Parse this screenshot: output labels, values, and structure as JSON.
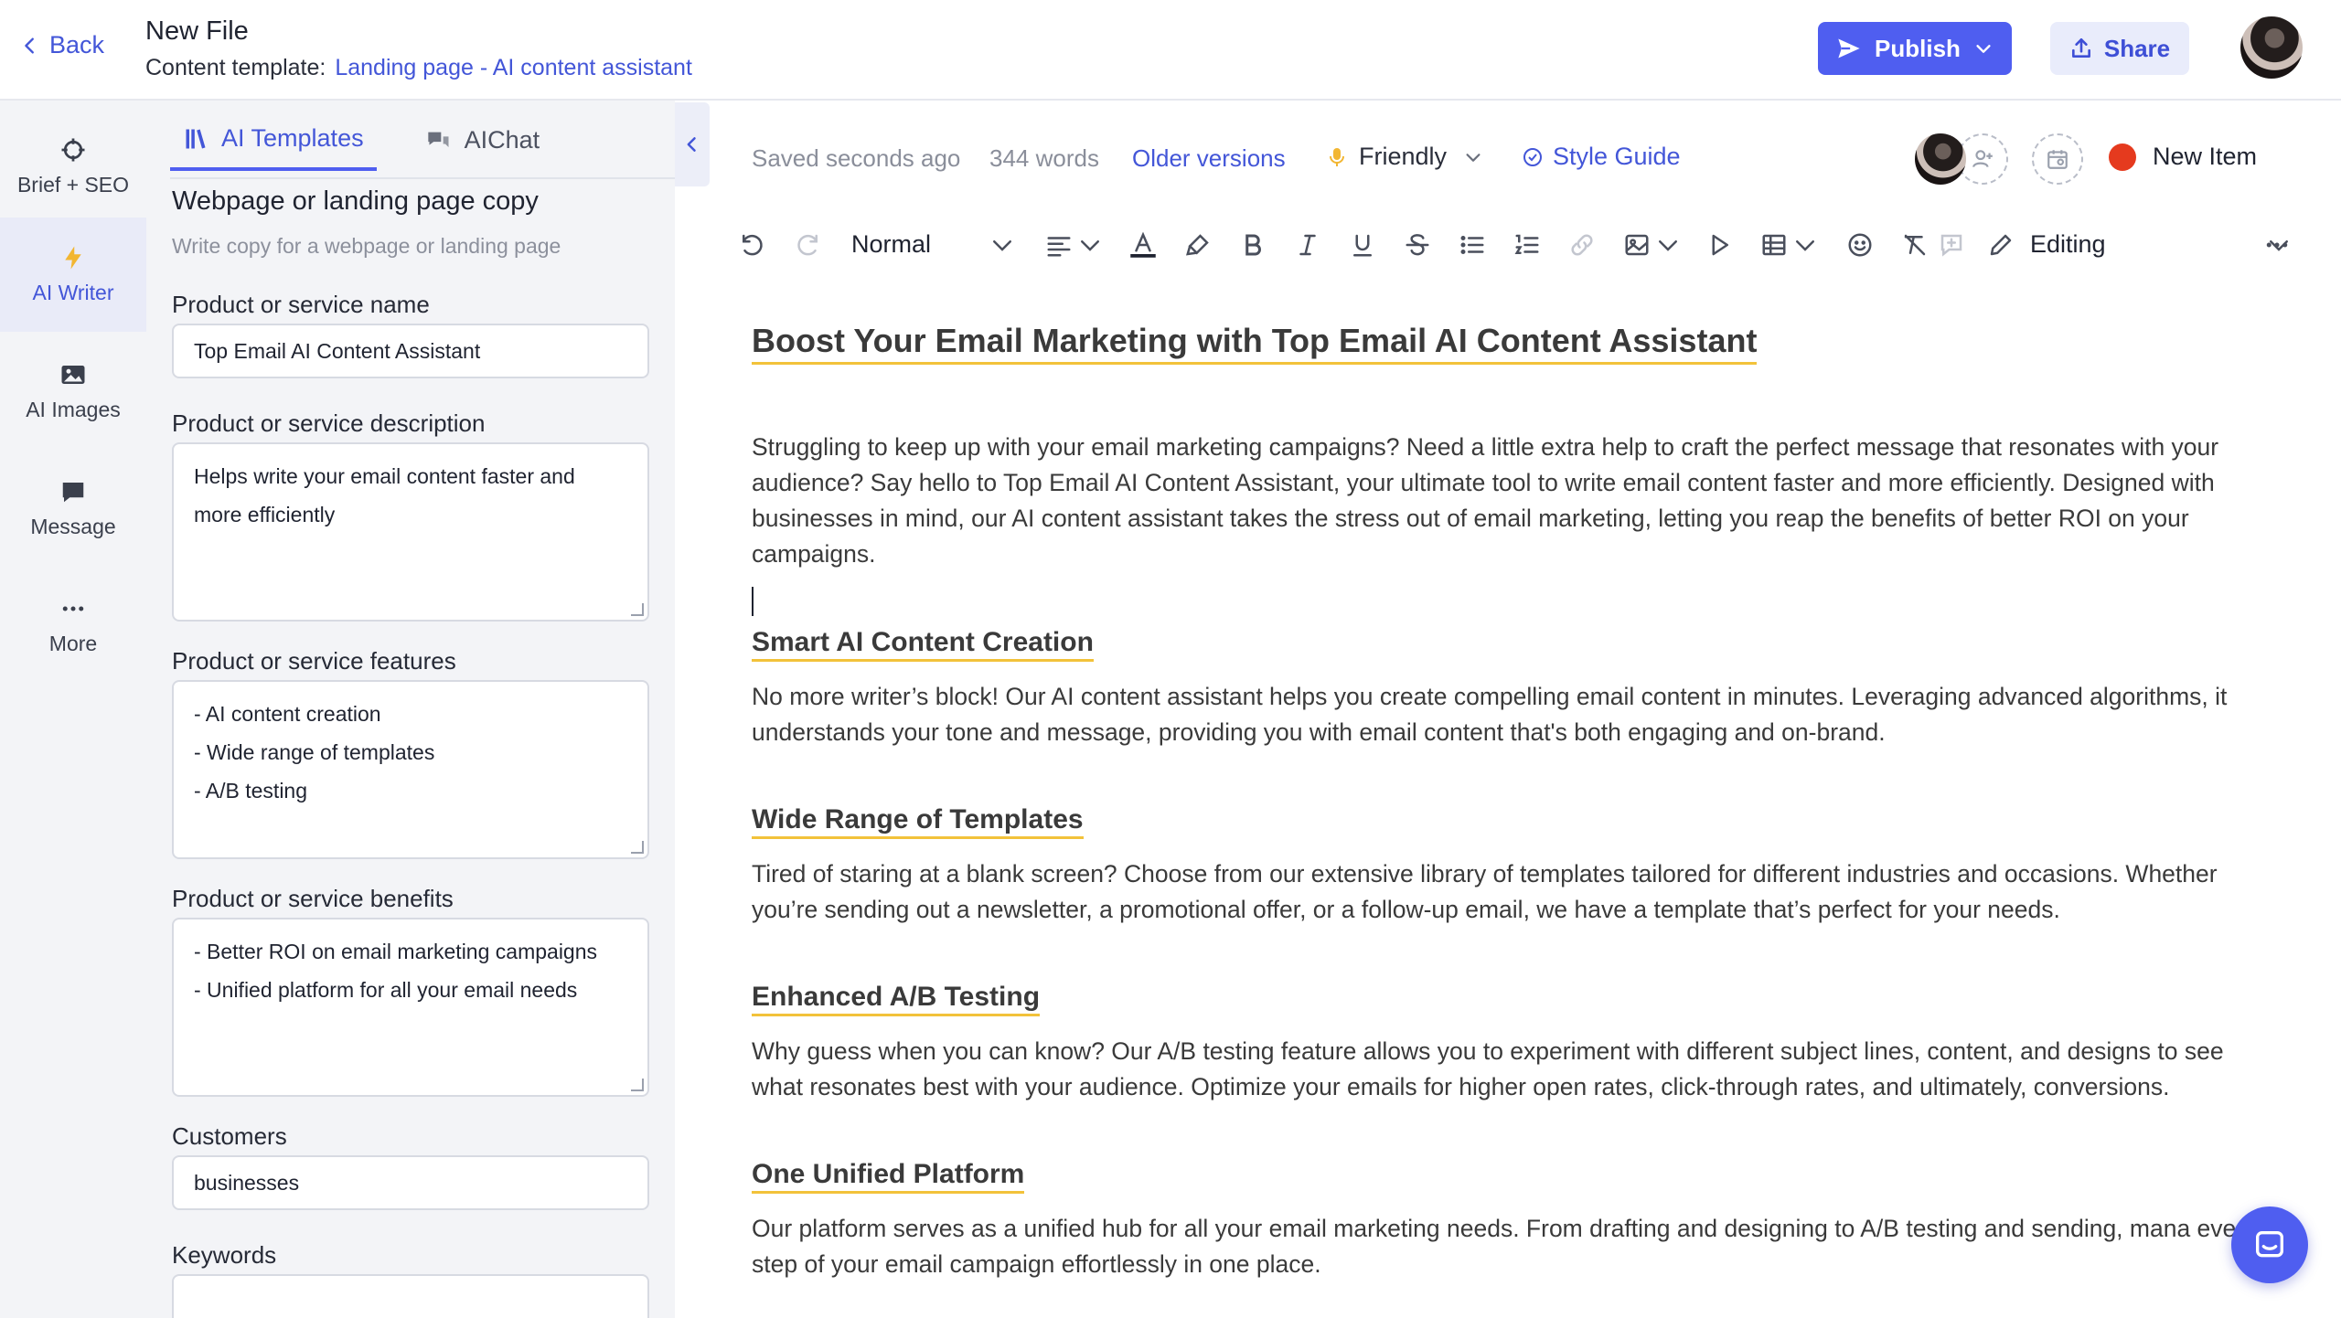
{
  "header": {
    "back_label": "Back",
    "file_title": "New File",
    "template_prefix": "Content template:",
    "template_name": "Landing page - AI content assistant",
    "publish_label": "Publish",
    "share_label": "Share"
  },
  "rail": {
    "items": [
      {
        "label": "Brief + SEO",
        "icon": "crosshair-icon"
      },
      {
        "label": "AI Writer",
        "icon": "lightning-icon"
      },
      {
        "label": "AI Images",
        "icon": "image-icon"
      },
      {
        "label": "Message",
        "icon": "message-icon"
      },
      {
        "label": "More",
        "icon": "more-icon"
      }
    ],
    "active": "AI Writer"
  },
  "panel": {
    "tabs": [
      {
        "label": "AI Templates",
        "active": true
      },
      {
        "label": "AIChat",
        "active": false
      }
    ],
    "title": "Webpage or landing page copy",
    "subtitle": "Write copy for a webpage or landing page",
    "fields": {
      "name": {
        "label": "Product or service name",
        "value": "Top Email AI Content Assistant"
      },
      "description": {
        "label": "Product or service description",
        "lines": [
          "Helps write your email content faster and",
          "more efficiently"
        ]
      },
      "features": {
        "label": "Product or service features",
        "lines": [
          "- AI content creation",
          "- Wide range of templates",
          "- A/B testing"
        ]
      },
      "benefits": {
        "label": "Product or service benefits",
        "lines": [
          "- Better ROI on email marketing campaigns",
          "- Unified platform for all your email needs"
        ]
      },
      "customers": {
        "label": "Customers",
        "value": "businesses"
      },
      "keywords": {
        "label": "Keywords",
        "value": ""
      }
    }
  },
  "meta": {
    "saved": "Saved seconds ago",
    "words": "344 words",
    "older_versions": "Older versions",
    "tone": "Friendly",
    "style_guide": "Style Guide",
    "new_item": "New Item"
  },
  "toolbar": {
    "block_style": "Normal",
    "mode": "Editing",
    "accent_color": "#4f5ef0",
    "status_dot_color": "#e53a1e"
  },
  "document": {
    "title": "Boost Your Email Marketing with Top Email AI Content Assistant",
    "intro": "Struggling to keep up with your email marketing campaigns? Need a little extra help to craft the perfect message that resonates with your audience? Say hello to Top Email AI Content Assistant, your ultimate tool to write email content faster and more efficiently. Designed with businesses in mind, our AI content assistant takes the stress out of email marketing, letting you reap the benefits of better ROI on your campaigns.",
    "sections": [
      {
        "heading": "Smart AI Content Creation",
        "body": "No more writer’s block! Our AI content assistant helps you create compelling email content in minutes. Leveraging advanced algorithms, it understands your tone and message, providing you with email content that's both engaging and on-brand."
      },
      {
        "heading": "Wide Range of Templates",
        "body": "Tired of staring at a blank screen? Choose from our extensive library of templates tailored for different industries and occasions. Whether you’re sending out a newsletter, a promotional offer, or a follow-up email, we have a template that’s perfect for your needs."
      },
      {
        "heading": "Enhanced A/B Testing",
        "body": "Why guess when you can know? Our A/B testing feature allows you to experiment with different subject lines, content, and designs to see what resonates best with your audience. Optimize your emails for higher open rates, click-through rates, and ultimately, conversions."
      },
      {
        "heading": "One Unified Platform",
        "body": "Our platform serves as a unified hub for all your email marketing needs. From drafting and designing to A/B testing and sending, mana every step of your email campaign effortlessly in one place."
      }
    ]
  }
}
